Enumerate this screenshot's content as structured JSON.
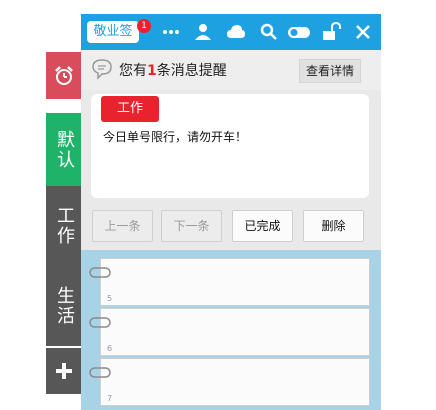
{
  "tabs": {
    "alarm_icon": "alarm-clock-icon",
    "default_label": "默认",
    "work_label": "工作",
    "life_label": "生活",
    "add_icon": "plus-icon"
  },
  "topbar": {
    "logo_text": "敬业签",
    "badge_count": "1",
    "icons": [
      "more-icon",
      "user-icon",
      "cloud-icon",
      "search-icon",
      "toggle-icon",
      "unlock-icon",
      "close-icon"
    ],
    "accent": "#1ea1e1"
  },
  "notice": {
    "prefix": "您有",
    "count": "1",
    "suffix": "条消息提醒",
    "detail_label": "查看详情"
  },
  "message": {
    "tag": "工作",
    "text": "今日单号限行，请勿开车！"
  },
  "actions": {
    "prev_label": "上一条",
    "next_label": "下一条",
    "done_label": "已完成",
    "delete_label": "删除"
  },
  "notes": [
    {
      "number": "5"
    },
    {
      "number": "6"
    },
    {
      "number": "7"
    }
  ],
  "colors": {
    "alarm_tab": "#d94c5c",
    "default_tab": "#1fb36a",
    "category_tab": "#575757",
    "badge_red": "#e8232e"
  }
}
